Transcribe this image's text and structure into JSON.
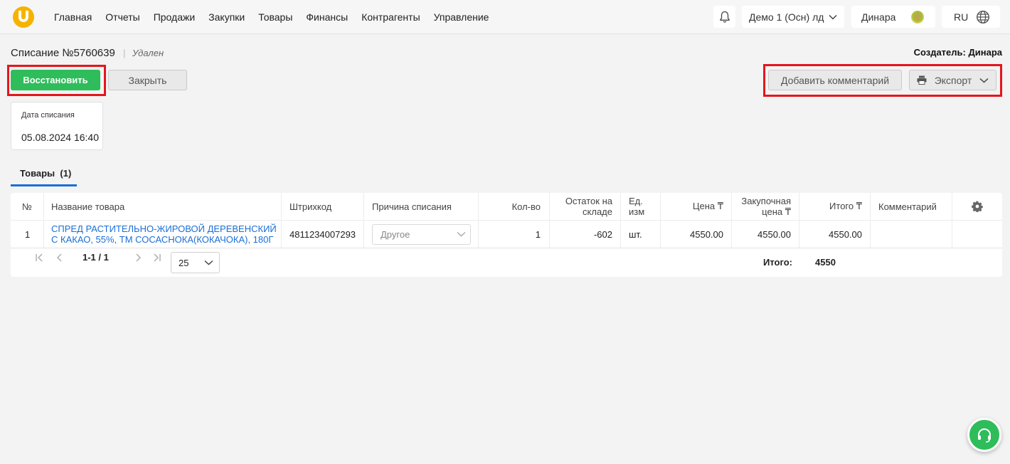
{
  "nav": {
    "items": [
      "Главная",
      "Отчеты",
      "Продажи",
      "Закупки",
      "Товары",
      "Финансы",
      "Контрагенты",
      "Управление"
    ],
    "company": "Демо 1 (Осн) лд",
    "user": "Динара",
    "language": "RU"
  },
  "doc": {
    "title": "Списание №5760639",
    "status": "Удален",
    "creator_label": "Создатель:",
    "creator_name": "Динара"
  },
  "actions": {
    "restore": "Восстановить",
    "close": "Закрыть",
    "add_comment": "Добавить комментарий",
    "export": "Экспорт"
  },
  "date_card": {
    "label": "Дата списания",
    "value": "05.08.2024 16:40"
  },
  "tabs": [
    {
      "label": "Товары  (1)"
    }
  ],
  "table": {
    "headers": {
      "num": "№",
      "name": "Название товара",
      "barcode": "Штрихкод",
      "reason": "Причина списания",
      "qty": "Кол-во",
      "stock_line1": "Остаток на",
      "stock_line2": "складе",
      "unit_line1": "Ед.",
      "unit_line2": "изм",
      "price": "Цена ₸",
      "purchase_line1": "Закупочная",
      "purchase_line2": "цена ₸",
      "total": "Итого ₸",
      "comment": "Комментарий"
    },
    "rows": [
      {
        "num": "1",
        "name_line1": "СПРЕД РАСТИТЕЛЬНО-ЖИРОВОЙ ДЕРЕВЕНСКИЙ",
        "name_line2": "С КАКАО, 55%, ТМ СОСАСНОКА(КОКАЧОКА), 180Г",
        "barcode": "4811234007293",
        "reason": "Другое",
        "qty": "1",
        "stock": "-602",
        "unit": "шт.",
        "price": "4550.00",
        "purchase_price": "4550.00",
        "total": "4550.00",
        "comment": ""
      }
    ]
  },
  "pagination": {
    "range": "1-1 / 1",
    "page_size": "25"
  },
  "summary": {
    "label": "Итого:",
    "value": "4550"
  },
  "colors": {
    "accent_green": "#2ebd5a",
    "link_blue": "#1a6fd6",
    "highlight_red": "#e3161d",
    "logo_yellow": "#f5b300"
  }
}
